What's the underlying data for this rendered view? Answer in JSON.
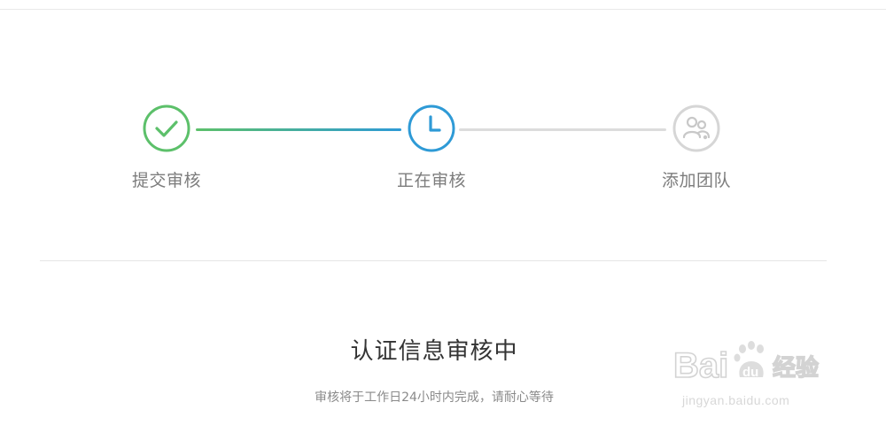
{
  "steps": [
    {
      "label": "提交审核",
      "state": "done",
      "icon": "check-icon",
      "color": "#5cc06a"
    },
    {
      "label": "正在审核",
      "state": "current",
      "icon": "clock-icon",
      "color": "#2e9ad6"
    },
    {
      "label": "添加团队",
      "state": "pending",
      "icon": "team-icon",
      "color": "#d6d6d6"
    }
  ],
  "status": {
    "title": "认证信息审核中",
    "subtitle": "审核将于工作日24小时内完成，请耐心等待"
  },
  "watermark": {
    "brand": "Bai",
    "brand_tail": "du",
    "product": "经验",
    "url": "jingyan.baidu.com"
  }
}
